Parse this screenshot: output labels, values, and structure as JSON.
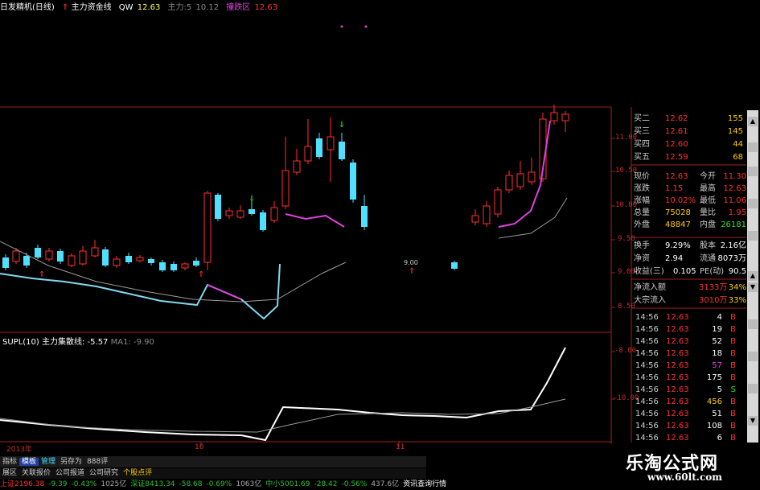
{
  "header": {
    "title": "日发精机(日线)",
    "indicator": "主力资金线",
    "qw_label": "QW",
    "qw_value": "12.63",
    "main_label": "主力:5",
    "main_value": "10.12",
    "signal_label": "撞跌区",
    "signal_value": "12.63"
  },
  "price_axis": [
    "11.00",
    "10.50",
    "10.00",
    "9.50",
    "9.00",
    "8.50"
  ],
  "sub_axis": [
    "-8.00",
    "-10.00"
  ],
  "sub_indicator": {
    "name": "SUPL(10)",
    "line_label": "主力集散线",
    "line_value": "-5.57",
    "ma_label": "MA1",
    "ma_value": "-9.90"
  },
  "date_labels": [
    "2013年",
    "10",
    "11"
  ],
  "chart_marker": "9.00",
  "quote_panel": {
    "order_book": [
      {
        "label": "买二",
        "price": "12.62",
        "vol": "155"
      },
      {
        "label": "买三",
        "price": "12.61",
        "vol": "145"
      },
      {
        "label": "买四",
        "price": "12.60",
        "vol": "44"
      },
      {
        "label": "买五",
        "price": "12.59",
        "vol": "68"
      }
    ],
    "stats": [
      {
        "l1": "现价",
        "v1": "12.63",
        "l2": "今开",
        "v2": "11.30"
      },
      {
        "l1": "涨跌",
        "v1": "1.15",
        "l2": "最高",
        "v2": "12.63"
      },
      {
        "l1": "涨幅",
        "v1": "10.02%",
        "l2": "最低",
        "v2": "11.06"
      },
      {
        "l1": "总量",
        "v1": "75028",
        "l2": "量比",
        "v2": "1.95"
      },
      {
        "l1": "外盘",
        "v1": "48847",
        "l2": "内盘",
        "v2": "26181"
      }
    ],
    "stats2": [
      {
        "l1": "换手",
        "v1": "9.29%",
        "l2": "股本",
        "v2": "2.16亿"
      },
      {
        "l1": "净资",
        "v1": "2.94",
        "l2": "流通",
        "v2": "8073万"
      },
      {
        "l1": "收益(三)",
        "v1": "0.105",
        "l2": "PE(动)",
        "v2": "90.5"
      }
    ],
    "flows": [
      {
        "label": "净流入额",
        "value": "3133万",
        "pct": "34%"
      },
      {
        "label": "大宗流入",
        "value": "3010万",
        "pct": "33%"
      }
    ],
    "ticks": [
      {
        "time": "14:56",
        "price": "12.63",
        "vol": "4",
        "dir": "B",
        "color": "#ffffff"
      },
      {
        "time": "14:56",
        "price": "12.63",
        "vol": "19",
        "dir": "B",
        "color": "#ffffff"
      },
      {
        "time": "14:56",
        "price": "12.63",
        "vol": "52",
        "dir": "B",
        "color": "#ffffff"
      },
      {
        "time": "14:56",
        "price": "12.63",
        "vol": "18",
        "dir": "B",
        "color": "#ffffff"
      },
      {
        "time": "14:56",
        "price": "12.63",
        "vol": "57",
        "dir": "B",
        "color": "#e040e0"
      },
      {
        "time": "14:56",
        "price": "12.63",
        "vol": "175",
        "dir": "B",
        "color": "#ffffff"
      },
      {
        "time": "14:56",
        "price": "12.63",
        "vol": "5",
        "dir": "S",
        "color": "#ffffff"
      },
      {
        "time": "14:56",
        "price": "12.63",
        "vol": "456",
        "dir": "B",
        "color": "#ffcc00"
      },
      {
        "time": "14:56",
        "price": "12.63",
        "vol": "51",
        "dir": "B",
        "color": "#ffffff"
      },
      {
        "time": "14:56",
        "price": "12.63",
        "vol": "108",
        "dir": "B",
        "color": "#ffffff"
      },
      {
        "time": "14:56",
        "price": "12.63",
        "vol": "6",
        "dir": "B",
        "color": "#ffffff"
      }
    ]
  },
  "bottom_tabs": [
    "指标",
    "模板",
    "管理",
    "另存为",
    "888评"
  ],
  "bottom_tabs2": [
    "展区",
    "关联报价",
    "公司报道",
    "公司研究",
    "个股点评"
  ],
  "status_bar": [
    {
      "text": "上证2196.38",
      "color": "#ff3030"
    },
    {
      "text": "-9.39",
      "color": "#30c030"
    },
    {
      "text": "-0.43%",
      "color": "#30c030"
    },
    {
      "text": "1025亿",
      "color": "#aaaaaa"
    },
    {
      "text": "深证8413.34",
      "color": "#30c030"
    },
    {
      "text": "-58.68",
      "color": "#30c030"
    },
    {
      "text": "-0.69%",
      "color": "#30c030"
    },
    {
      "text": "1063亿",
      "color": "#aaaaaa"
    },
    {
      "text": "中小5001.69",
      "color": "#30c030"
    },
    {
      "text": "-28.42",
      "color": "#30c030"
    },
    {
      "text": "-0.56%",
      "color": "#30c030"
    },
    {
      "text": "437.6亿",
      "color": "#aaaaaa"
    },
    {
      "text": "资讯查询行情",
      "color": "#ffffff"
    }
  ],
  "watermark": {
    "line1": "乐淘公式网",
    "line2": "www.60lt.com"
  },
  "colors": {
    "up": "#ff3030",
    "down": "#50e0ff",
    "grid": "#a02020",
    "bg": "#000000",
    "purple": "#e040e0"
  }
}
